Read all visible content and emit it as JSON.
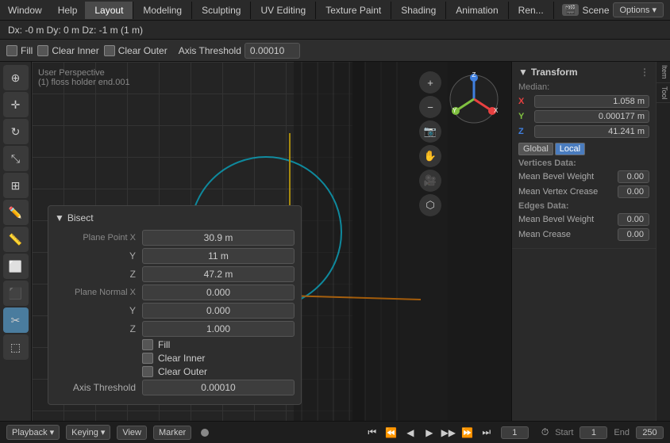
{
  "topMenu": {
    "items": [
      "Window",
      "Help"
    ],
    "workspaceTabs": [
      "Layout",
      "Modeling",
      "Sculpting",
      "UV Editing",
      "Texture Paint",
      "Shading",
      "Animation",
      "Ren..."
    ],
    "activeTab": "Layout",
    "sceneIcon": "🎬",
    "sceneName": "Scene",
    "optionsLabel": "Options ▾"
  },
  "headerBar": {
    "coords": "Dx: -0 m  Dy: 0 m  Dz: -1 m (1 m)"
  },
  "operatorBar": {
    "fillLabel": "Fill",
    "clearInnerLabel": "Clear Inner",
    "clearOuterLabel": "Clear Outer",
    "thresholdLabel": "Axis Threshold",
    "thresholdValue": "0.00010"
  },
  "viewport": {
    "perspLabel": "User Perspective",
    "objectLabel": "(1) floss holder end.001"
  },
  "bisect": {
    "header": "Bisect",
    "planePointLabel": "Plane Point",
    "xLabel": "X",
    "yLabel": "Y",
    "zLabel": "Z",
    "xValue": "30.9 m",
    "yValue": "11 m",
    "zValue": "47.2 m",
    "planeNormalLabel": "Plane Normal",
    "nxValue": "0.000",
    "nyValue": "0.000",
    "nzValue": "1.000",
    "fillLabel": "Fill",
    "clearInnerLabel": "Clear Inner",
    "clearOuterLabel": "Clear Outer",
    "axisThresholdLabel": "Axis Threshold",
    "axisThresholdValue": "0.00010"
  },
  "rightPanel": {
    "transformHeader": "Transform",
    "medianLabel": "Median:",
    "xLabel": "X",
    "yLabel": "Y",
    "zLabel": "Z",
    "xValue": "1.058 m",
    "yValue": "0.000177 m",
    "zValue": "41.241 m",
    "globalLabel": "Global",
    "localLabel": "Local",
    "verticesDataLabel": "Vertices Data:",
    "meanBevelWeightLabel": "Mean Bevel Weight",
    "meanBevelWeightValue": "0.00",
    "meanVertexCreaseLabel": "Mean Vertex Crease",
    "meanVertexCreaseValue": "0.00",
    "edgesDataLabel": "Edges Data:",
    "meanBevelWeightEdgeLabel": "Mean Bevel Weight",
    "meanBevelWeightEdgeValue": "0.00",
    "meanCreaseLabel": "Mean Crease",
    "meanCreaseValue": "0.00",
    "tabs": [
      "Item",
      "Tool"
    ]
  },
  "bottomBar": {
    "playbackLabel": "Playback",
    "keyingLabel": "Keying",
    "viewLabel": "View",
    "markerLabel": "Marker",
    "startLabel": "Start",
    "startValue": "1",
    "endLabel": "End",
    "endValue": "250",
    "currentFrame": "1"
  },
  "gizmo": {
    "xColor": "#e84040",
    "yColor": "#80c040",
    "zColor": "#4080e0",
    "zLabel": "Z"
  },
  "navButtons": {
    "zoomIn": "+",
    "zoomOut": "-",
    "camera": "📷",
    "move": "✋",
    "perspective": "🎥",
    "ortho": "⬡"
  }
}
